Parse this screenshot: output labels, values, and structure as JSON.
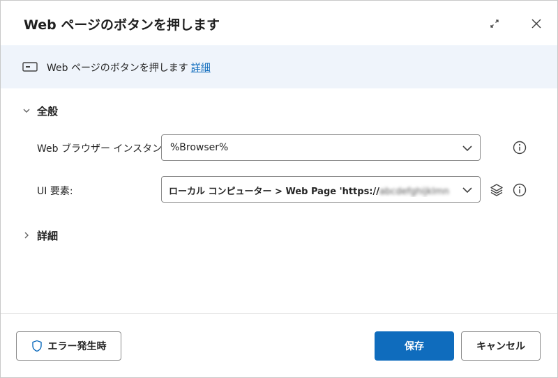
{
  "dialog": {
    "title": "Web ページのボタンを押します",
    "expand_icon": "expand-icon",
    "close_icon": "close-icon"
  },
  "banner": {
    "icon": "web-button-icon",
    "description": "Web ページのボタンを押します",
    "details_link": "詳細"
  },
  "general_section": {
    "label": "全般",
    "expanded": true,
    "fields": {
      "browser": {
        "label": "Web ブラウザー インスタンス:",
        "value": "%Browser%"
      },
      "ui_element": {
        "label": "UI 要素:",
        "value_prefix": "ローカル コンピューター > Web Page 'https://",
        "value_redacted": "abcdefghijklmn"
      }
    }
  },
  "advanced_section": {
    "label": "詳細",
    "expanded": false
  },
  "footer": {
    "on_error_label": "エラー発生時",
    "save_label": "保存",
    "cancel_label": "キャンセル"
  },
  "colors": {
    "accent": "#0f6cbd",
    "banner_bg": "#eff4fb",
    "border": "#8a8a8a"
  }
}
